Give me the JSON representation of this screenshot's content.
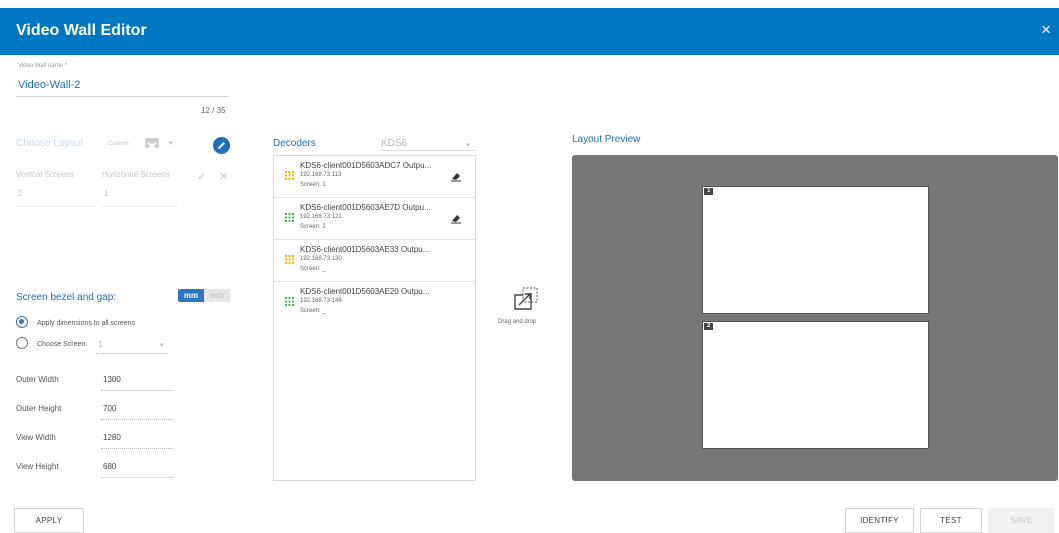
{
  "header": {
    "title": "Video Wall Editor",
    "close": "×"
  },
  "name_field": {
    "label": "Video Wall name *",
    "value": "Video-Wall-2",
    "counter": "12 / 35"
  },
  "layout": {
    "label": "Choose Layout",
    "selected": "Custom",
    "vertical_label": "Vertical Screens",
    "vertical_value": "2",
    "horizontal_label": "Horizontal Screens",
    "horizontal_value": "1"
  },
  "bezel": {
    "label": "Screen bezel and gap:",
    "unit_mm": "mm",
    "unit_inch": "inch",
    "apply_all_label": "Apply dimensions to all screens",
    "choose_screen_label": "Choose Screen",
    "choose_screen_value": "1",
    "fields": [
      {
        "label": "Outer Width",
        "value": "1300"
      },
      {
        "label": "Outer Height",
        "value": "700"
      },
      {
        "label": "View Width",
        "value": "1280"
      },
      {
        "label": "View Height",
        "value": "680"
      }
    ]
  },
  "decoders": {
    "label": "Decoders",
    "filter": "KDS6",
    "items": [
      {
        "name": "KDS6-client001D5603ADC7 Outpu...",
        "ip": "192.168.73.113",
        "screen": "Screen: 1",
        "color": "#f0b400"
      },
      {
        "name": "KDS6-client001D5603AE7D Outpu...",
        "ip": "192.168.73.121",
        "screen": "Screen: 2",
        "color": "#4caf50"
      },
      {
        "name": "KDS6-client001D5603AE33 Outpu...",
        "ip": "192.168.73.130",
        "screen": "Screen: _",
        "color": "#f0b400"
      },
      {
        "name": "KDS6-client001D5603AE20 Outpu...",
        "ip": "192.168.73.148",
        "screen": "Screen: _",
        "color": "#4caf50"
      }
    ]
  },
  "drag_drop_label": "Drag and drop",
  "preview": {
    "label": "Layout Preview",
    "screens": [
      "1",
      "2"
    ]
  },
  "buttons": {
    "apply": "APPLY",
    "identify": "IDENTIFY",
    "test": "TEST",
    "save": "SAVE"
  }
}
